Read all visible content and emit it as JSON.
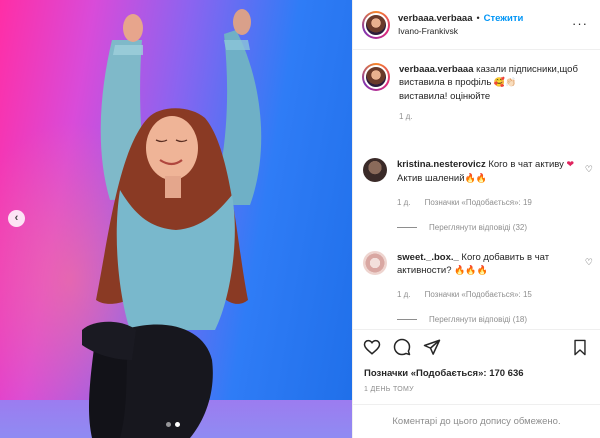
{
  "post": {
    "username": "verbaaa.verbaaa",
    "separator": "•",
    "follow_label": "Стежити",
    "location": "Ivano-Frankivsk",
    "more_label": "···"
  },
  "caption": {
    "username": "verbaaa.verbaaa",
    "text_line1": "казали підписники,щоб виставила в профіль",
    "emoji": "🥰👏🏻",
    "text_line2": "виставила! оцінюйте",
    "time": "1 д."
  },
  "comments": [
    {
      "username": "kristina.nesterovicz",
      "text_a": "Кого в чат активу",
      "emoji_a": "❤",
      "text_b": "Актив шалений",
      "emoji_b": "🔥🔥",
      "time": "1 д.",
      "likes": "Позначки «Подобається»: 19",
      "replies": "Переглянути відповіді (32)"
    },
    {
      "username": "sweet._.box._",
      "text_a": "Кого добавить в чат активности?",
      "emoji_a": "🔥🔥🔥",
      "time": "1 д.",
      "likes": "Позначки «Подобається»: 15",
      "replies": "Переглянути відповіді (18)"
    }
  ],
  "nav": {
    "prev_label": "‹"
  },
  "likes_total": "Позначки «Подобається»: 170 636",
  "posted_ago": "1 ДЕНЬ ТОМУ",
  "comments_closed": "Коментарі до цього допису обмежено.",
  "colors": {
    "accent": "#0095f6",
    "muted": "#8e8e8e",
    "text": "#262626"
  }
}
